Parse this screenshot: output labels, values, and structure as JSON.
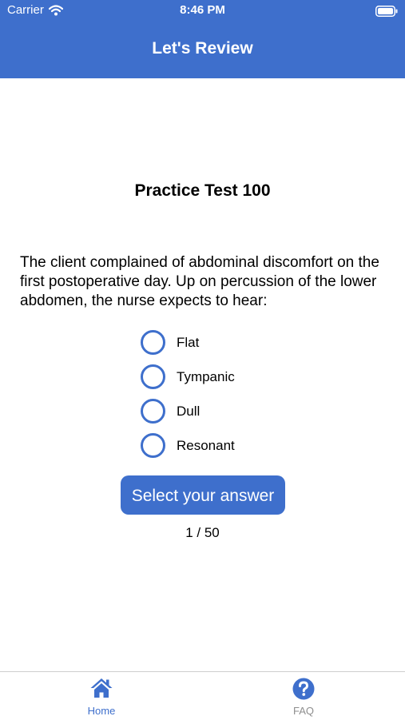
{
  "status_bar": {
    "carrier": "Carrier",
    "time": "8:46 PM"
  },
  "header": {
    "title": "Let's Review"
  },
  "test": {
    "title": "Practice Test 100",
    "question": "The client complained of abdominal discomfort on the first postoperative day. Up on percussion of the lower abdomen, the nurse expects to hear:",
    "options": [
      "Flat",
      "Tympanic",
      "Dull",
      "Resonant"
    ],
    "submit_label": "Select your answer",
    "progress": "1 / 50"
  },
  "tabbar": {
    "tabs": [
      {
        "label": "Home",
        "icon": "home-icon",
        "active": true
      },
      {
        "label": "FAQ",
        "icon": "question-circle-icon",
        "active": false
      }
    ]
  },
  "colors": {
    "accent": "#3e6fcc",
    "inactive_tab": "#8e8e8e"
  }
}
